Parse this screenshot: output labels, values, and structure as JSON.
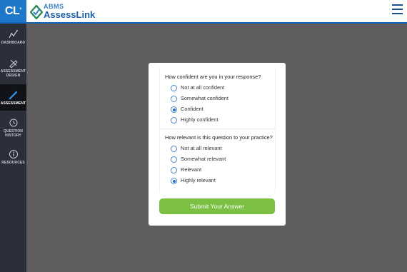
{
  "header": {
    "cl_logo_text": "CL",
    "cl_logo_sup": "+",
    "brand_top": "ABMS",
    "brand_name": "AssessLink",
    "menu_icon": "hamburger-icon"
  },
  "sidebar": {
    "items": [
      {
        "label": "DASHBOARD",
        "icon": "chart-line-icon",
        "active": false
      },
      {
        "label": "ASSESSMENT DESIGN",
        "icon": "pencil-ruler-icon",
        "active": false
      },
      {
        "label": "ASSESSMENT",
        "icon": "pencil-icon",
        "active": true
      },
      {
        "label": "QUESTION HISTORY",
        "icon": "history-icon",
        "active": false
      },
      {
        "label": "RESOURCES",
        "icon": "info-icon",
        "active": false
      }
    ]
  },
  "questions": [
    {
      "title": "How confident are you in your response?",
      "options": [
        "Not at all confident",
        "Somewhat confident",
        "Confident",
        "Highly confident"
      ],
      "selected": "Confident"
    },
    {
      "title": "How relevant is this question to your practice?",
      "options": [
        "Not at all relevant",
        "Somewhat relevant",
        "Relevant",
        "Highly relevant"
      ],
      "selected": "Highly relevant"
    }
  ],
  "submit_label": "Submit Your Answer",
  "colors": {
    "brand_blue": "#1f77c9",
    "submit_green": "#7bbf43",
    "sidebar_bg": "#2b2f3a",
    "backdrop": "#5e5e5e"
  }
}
